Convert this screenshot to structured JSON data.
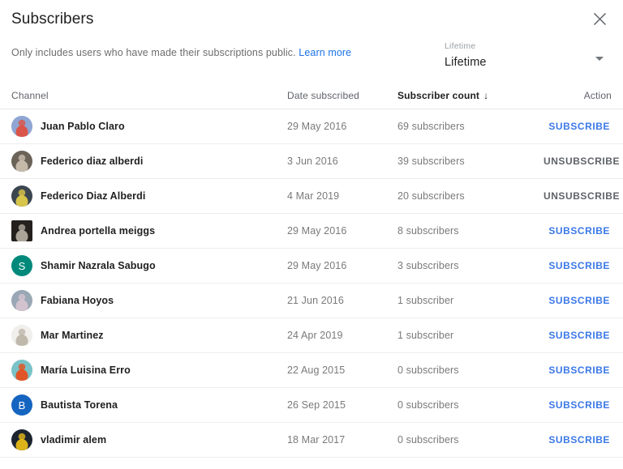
{
  "dialog": {
    "title": "Subscribers",
    "close_icon": "close-icon"
  },
  "notice": {
    "text": "Only includes users who have made their subscriptions public.",
    "link_label": "Learn more"
  },
  "period_select": {
    "floating_label": "Lifetime",
    "value": "Lifetime",
    "arrow_icon": "chevron-down-icon"
  },
  "table": {
    "headers": {
      "channel": "Channel",
      "date": "Date subscribed",
      "count": "Subscriber count",
      "action": "Action"
    },
    "sort": {
      "column": "Subscriber count",
      "direction": "descending",
      "arrow_glyph": "↓"
    },
    "rows": [
      {
        "name": "Juan Pablo Claro",
        "date": "29 May 2016",
        "count": "69 subscribers",
        "action": "SUBSCRIBE",
        "action_state": "subscribe",
        "avatar": {
          "type": "photo",
          "shape": "circle",
          "bg": "#8fa6d4",
          "fg": "#e34b3a"
        }
      },
      {
        "name": "Federico diaz alberdi",
        "date": "3 Jun 2016",
        "count": "39 subscribers",
        "action": "UNSUBSCRIBE",
        "action_state": "unsubscribe",
        "avatar": {
          "type": "photo",
          "shape": "circle",
          "bg": "#6b6258",
          "fg": "#cfc4b4"
        }
      },
      {
        "name": "Federico Diaz Alberdi",
        "date": "4 Mar 2019",
        "count": "20 subscribers",
        "action": "UNSUBSCRIBE",
        "action_state": "unsubscribe",
        "avatar": {
          "type": "photo",
          "shape": "circle",
          "bg": "#3c4650",
          "fg": "#e8d24a"
        }
      },
      {
        "name": "Andrea portella meiggs",
        "date": "29 May 2016",
        "count": "8 subscribers",
        "action": "SUBSCRIBE",
        "action_state": "subscribe",
        "avatar": {
          "type": "photo",
          "shape": "square",
          "bg": "#23201d",
          "fg": "#b9b2a6"
        }
      },
      {
        "name": "Shamir Nazrala Sabugo",
        "date": "29 May 2016",
        "count": "3 subscribers",
        "action": "SUBSCRIBE",
        "action_state": "subscribe",
        "avatar": {
          "type": "initial",
          "shape": "circle",
          "letter": "S",
          "bg": "#00897b",
          "fg": "#ffffff"
        }
      },
      {
        "name": "Fabiana Hoyos",
        "date": "21 Jun 2016",
        "count": "1 subscriber",
        "action": "SUBSCRIBE",
        "action_state": "subscribe",
        "avatar": {
          "type": "photo",
          "shape": "circle",
          "bg": "#9aa7b5",
          "fg": "#d8c7d2"
        }
      },
      {
        "name": "Mar Martinez",
        "date": "24 Apr 2019",
        "count": "1 subscriber",
        "action": "SUBSCRIBE",
        "action_state": "subscribe",
        "avatar": {
          "type": "photo",
          "shape": "circle",
          "bg": "#f0efec",
          "fg": "#b9b2a4"
        }
      },
      {
        "name": "María Luisina Erro",
        "date": "22 Aug 2015",
        "count": "0 subscribers",
        "action": "SUBSCRIBE",
        "action_state": "subscribe",
        "avatar": {
          "type": "photo",
          "shape": "circle",
          "bg": "#79c3c8",
          "fg": "#ec4a16"
        }
      },
      {
        "name": "Bautista Torena",
        "date": "26 Sep 2015",
        "count": "0 subscribers",
        "action": "SUBSCRIBE",
        "action_state": "subscribe",
        "avatar": {
          "type": "initial",
          "shape": "circle",
          "letter": "B",
          "bg": "#1565c0",
          "fg": "#ffffff"
        }
      },
      {
        "name": "vladimir alem",
        "date": "18 Mar 2017",
        "count": "0 subscribers",
        "action": "SUBSCRIBE",
        "action_state": "subscribe",
        "avatar": {
          "type": "photo",
          "shape": "circle",
          "bg": "#1c2430",
          "fg": "#f2c317"
        }
      }
    ]
  },
  "colors": {
    "link": "#1a73e8",
    "subscribe": "#3b78e7",
    "unsubscribe": "#5f6368",
    "divider": "#eeeeee"
  }
}
